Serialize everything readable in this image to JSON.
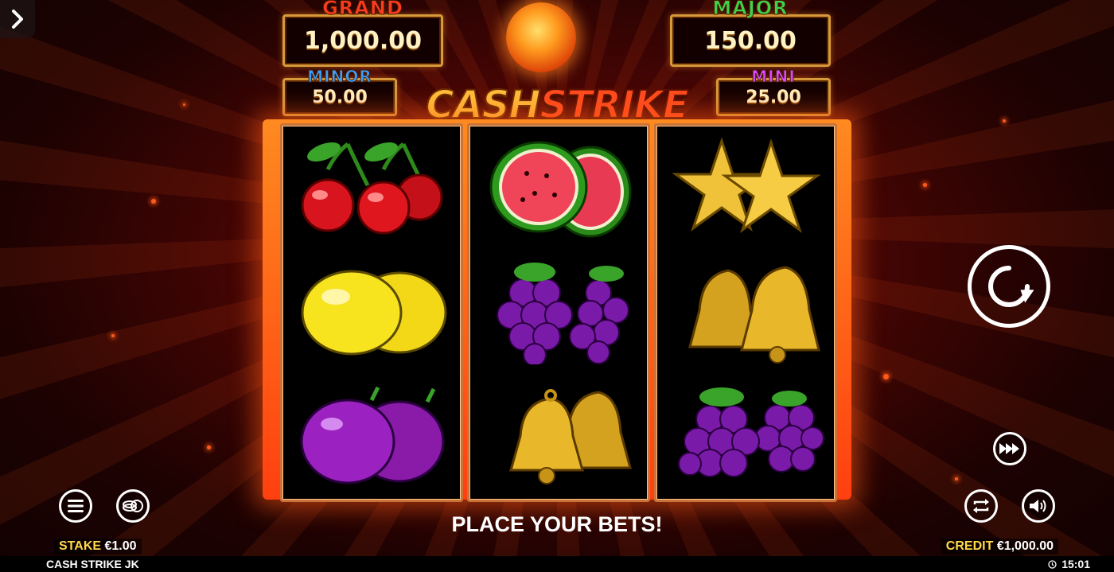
{
  "nav": {
    "back_icon": "chevron-right-icon"
  },
  "jackpots": {
    "grand": {
      "label": "GRAND",
      "value": "1,000.00",
      "color": "#ff3b1e"
    },
    "major": {
      "label": "MAJOR",
      "value": "150.00",
      "color": "#3fd14a"
    },
    "minor": {
      "label": "MINOR",
      "value": "50.00",
      "color": "#3aa0ff"
    },
    "mini": {
      "label": "MINI",
      "value": "25.00",
      "color": "#d84aff"
    }
  },
  "logo": {
    "word1": "CASH",
    "word2": "STRIKE"
  },
  "reels": [
    [
      "cherries",
      "lemons",
      "plums"
    ],
    [
      "watermelons",
      "grapes",
      "bells"
    ],
    [
      "stars",
      "bells",
      "grapes"
    ]
  ],
  "controls": {
    "spin_icon": "spin-icon",
    "turbo_icon": "fast-forward-icon",
    "menu_icon": "menu-icon",
    "coins_icon": "coins-icon",
    "autoplay_icon": "autoplay-icon",
    "sound_icon": "speaker-icon"
  },
  "message": "PLACE YOUR BETS!",
  "stake": {
    "label": "STAKE",
    "value": "€1.00"
  },
  "credit": {
    "label": "CREDIT",
    "value": "€1,000.00"
  },
  "footer": {
    "game_name": "CASH STRIKE JK",
    "time": "15:01"
  }
}
